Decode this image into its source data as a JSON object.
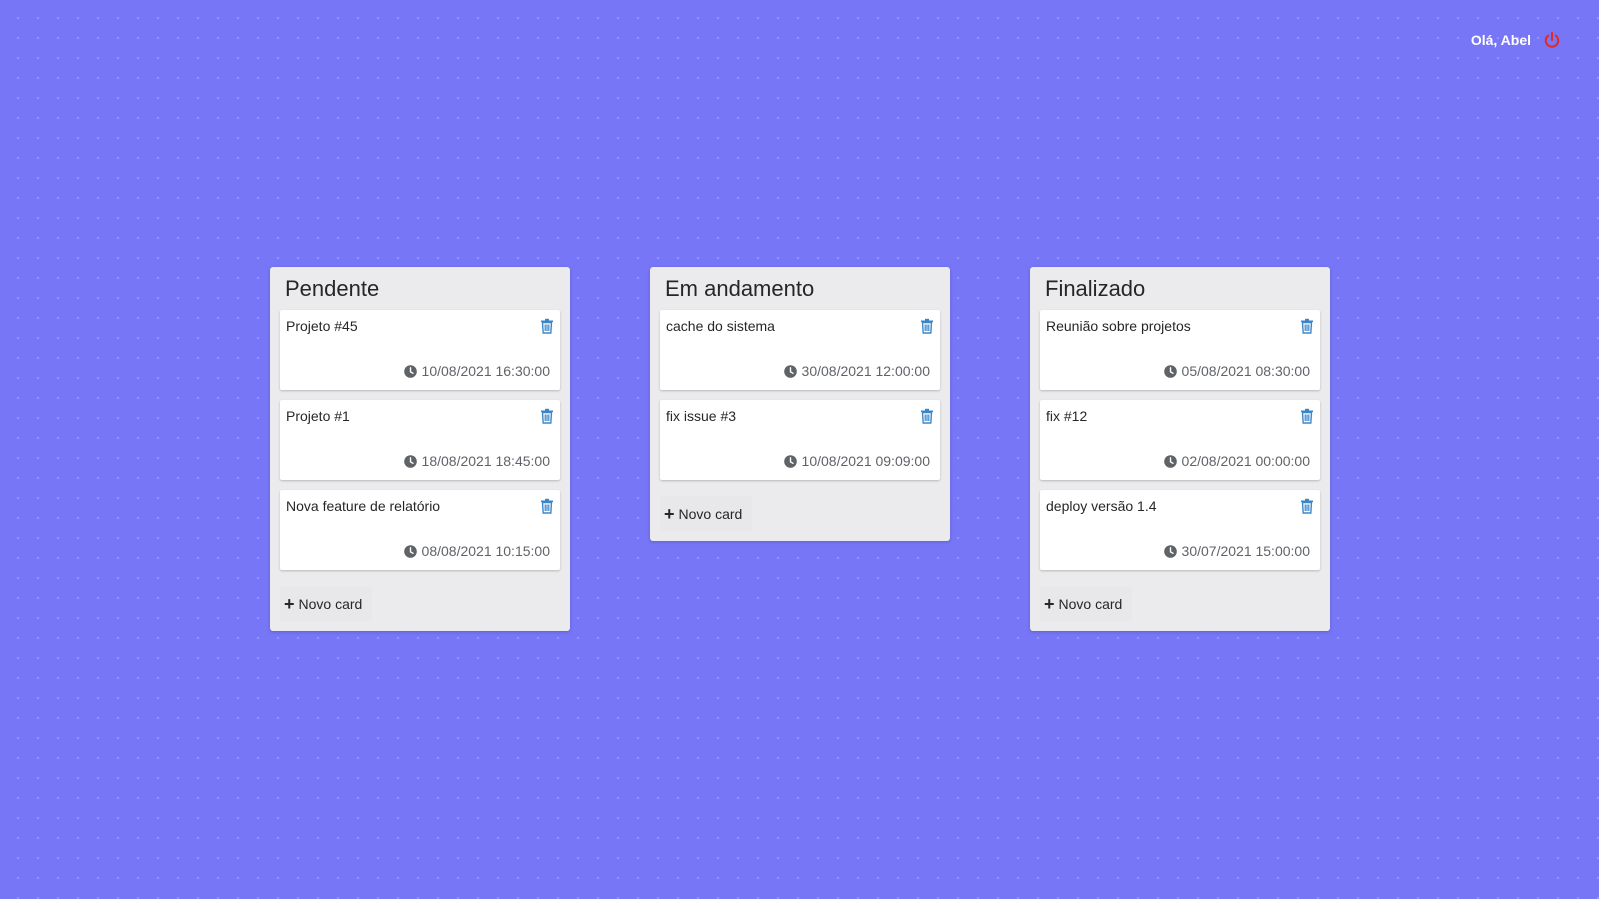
{
  "header": {
    "greeting": "Olá, Abel",
    "logout_icon": "power-icon",
    "logout_color": "#e02a2a"
  },
  "colors": {
    "background": "#7676f7",
    "column": "#ebebed",
    "card": "#ffffff",
    "icon_blue": "#3b86c8"
  },
  "columns": [
    {
      "title": "Pendente",
      "add_label": "Novo card",
      "cards": [
        {
          "title": "Projeto #45",
          "date": "10/08/2021 16:30:00"
        },
        {
          "title": "Projeto #1",
          "date": "18/08/2021 18:45:00"
        },
        {
          "title": "Nova feature de relatório",
          "date": "08/08/2021 10:15:00"
        }
      ]
    },
    {
      "title": "Em andamento",
      "add_label": "Novo card",
      "cards": [
        {
          "title": "cache do sistema",
          "date": "30/08/2021 12:00:00"
        },
        {
          "title": "fix issue #3",
          "date": "10/08/2021 09:09:00"
        }
      ]
    },
    {
      "title": "Finalizado",
      "add_label": "Novo card",
      "cards": [
        {
          "title": "Reunião sobre projetos",
          "date": "05/08/2021 08:30:00"
        },
        {
          "title": "fix #12",
          "date": "02/08/2021 00:00:00"
        },
        {
          "title": "deploy versão 1.4",
          "date": "30/07/2021 15:00:00"
        }
      ]
    }
  ]
}
